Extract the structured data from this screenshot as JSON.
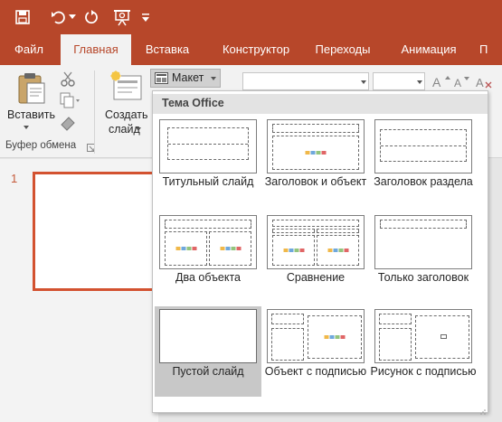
{
  "quick_access": {
    "save_icon": "save-icon",
    "undo_icon": "undo-icon",
    "redo_icon": "redo-icon",
    "present_icon": "present-icon",
    "customize_icon": "customize-qat-icon"
  },
  "tabs": [
    {
      "label": "Файл",
      "active": false
    },
    {
      "label": "Главная",
      "active": true
    },
    {
      "label": "Вставка",
      "active": false
    },
    {
      "label": "Конструктор",
      "active": false
    },
    {
      "label": "Переходы",
      "active": false
    },
    {
      "label": "Анимация",
      "active": false
    }
  ],
  "ribbon": {
    "paste_label": "Вставить",
    "clipboard_group": "Буфер обмена",
    "new_slide_label_1": "Создать",
    "new_slide_label_2": "слайд",
    "layout_button": "Макет"
  },
  "slides_pane": {
    "slide_number": "1"
  },
  "layout_gallery": {
    "header": "Тема Office",
    "layouts": [
      {
        "label": "Титульный слайд",
        "kind": "title"
      },
      {
        "label": "Заголовок и объект",
        "kind": "title-content"
      },
      {
        "label": "Заголовок раздела",
        "kind": "section"
      },
      {
        "label": "Два объекта",
        "kind": "two-content"
      },
      {
        "label": "Сравнение",
        "kind": "comparison"
      },
      {
        "label": "Только заголовок",
        "kind": "title-only"
      },
      {
        "label": "Пустой слайд",
        "kind": "blank",
        "selected": true
      },
      {
        "label": "Объект с подписью",
        "kind": "content-caption"
      },
      {
        "label": "Рисунок с подписью",
        "kind": "picture-caption"
      }
    ]
  },
  "colors": {
    "accent": "#b7472a",
    "slide_border": "#d35230"
  }
}
